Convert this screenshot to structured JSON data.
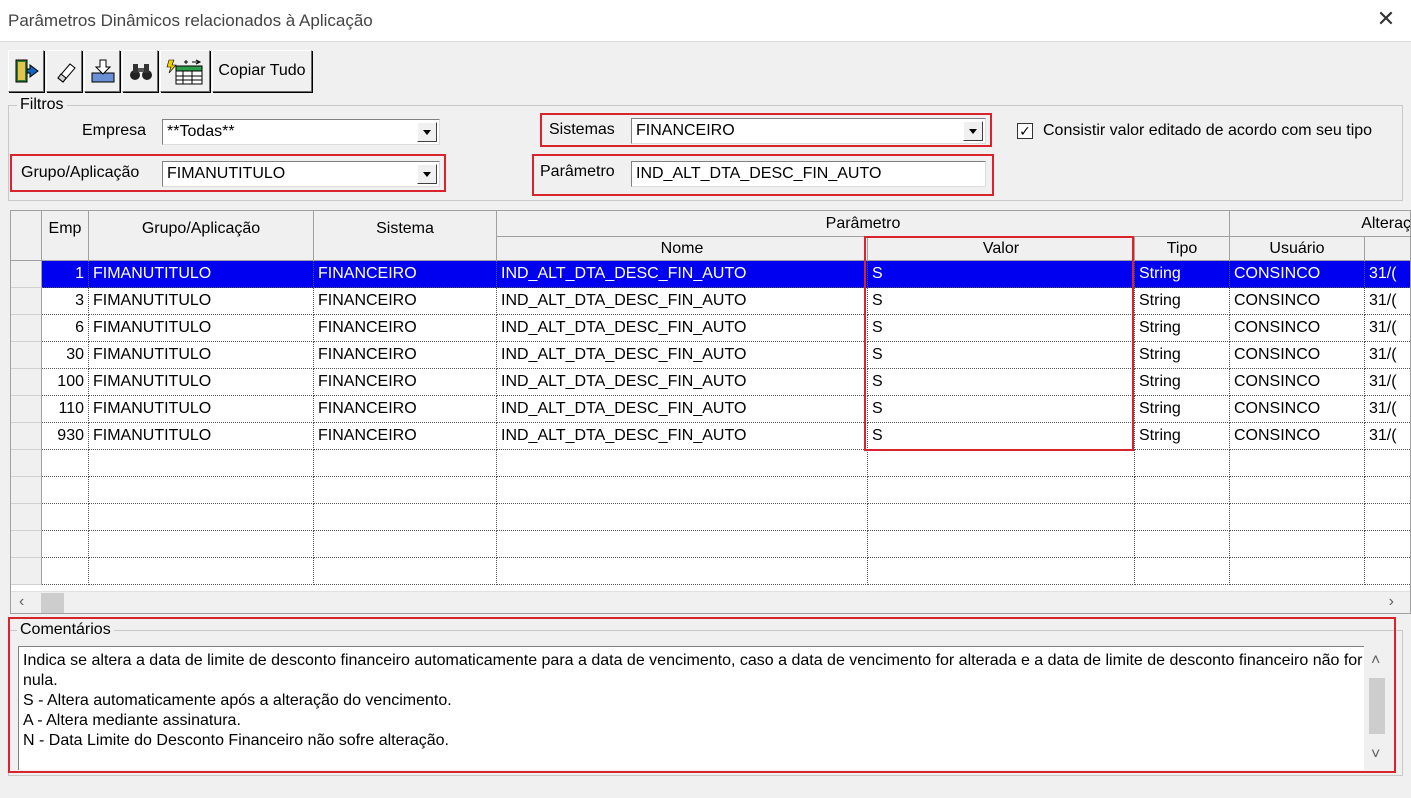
{
  "window": {
    "title": "Parâmetros Dinâmicos relacionados à Aplicação"
  },
  "toolbar": {
    "buttons": [
      {
        "icon": "exit-door-icon"
      },
      {
        "icon": "eraser-icon"
      },
      {
        "icon": "save-download-icon"
      },
      {
        "icon": "binoculars-icon"
      },
      {
        "icon": "grid-table-icon"
      }
    ],
    "copy_all_label": "Copiar Tudo"
  },
  "filters": {
    "legend": "Filtros",
    "empresa_label": "Empresa",
    "empresa_value": "**Todas**",
    "grupo_label": "Grupo/Aplicação",
    "grupo_value": "FIMANUTITULO",
    "sistemas_label": "Sistemas",
    "sistemas_value": "FINANCEIRO",
    "parametro_label": "Parâmetro",
    "parametro_value": "IND_ALT_DTA_DESC_FIN_AUTO",
    "consistir_label": "Consistir valor editado de acordo com seu tipo",
    "consistir_checked": true
  },
  "grid": {
    "headers": {
      "emp": "Emp",
      "grupo": "Grupo/Aplicação",
      "sistema": "Sistema",
      "parametro": "Parâmetro",
      "nome": "Nome",
      "valor": "Valor",
      "tipo": "Tipo",
      "alteracao": "Alteraç",
      "usuario": "Usuário"
    },
    "rows": [
      {
        "emp": "1",
        "grupo": "FIMANUTITULO",
        "sistema": "FINANCEIRO",
        "nome": "IND_ALT_DTA_DESC_FIN_AUTO",
        "valor": "S",
        "tipo": "String",
        "usuario": "CONSINCO",
        "data": "31/("
      },
      {
        "emp": "3",
        "grupo": "FIMANUTITULO",
        "sistema": "FINANCEIRO",
        "nome": "IND_ALT_DTA_DESC_FIN_AUTO",
        "valor": "S",
        "tipo": "String",
        "usuario": "CONSINCO",
        "data": "31/("
      },
      {
        "emp": "6",
        "grupo": "FIMANUTITULO",
        "sistema": "FINANCEIRO",
        "nome": "IND_ALT_DTA_DESC_FIN_AUTO",
        "valor": "S",
        "tipo": "String",
        "usuario": "CONSINCO",
        "data": "31/("
      },
      {
        "emp": "30",
        "grupo": "FIMANUTITULO",
        "sistema": "FINANCEIRO",
        "nome": "IND_ALT_DTA_DESC_FIN_AUTO",
        "valor": "S",
        "tipo": "String",
        "usuario": "CONSINCO",
        "data": "31/("
      },
      {
        "emp": "100",
        "grupo": "FIMANUTITULO",
        "sistema": "FINANCEIRO",
        "nome": "IND_ALT_DTA_DESC_FIN_AUTO",
        "valor": "S",
        "tipo": "String",
        "usuario": "CONSINCO",
        "data": "31/("
      },
      {
        "emp": "110",
        "grupo": "FIMANUTITULO",
        "sistema": "FINANCEIRO",
        "nome": "IND_ALT_DTA_DESC_FIN_AUTO",
        "valor": "S",
        "tipo": "String",
        "usuario": "CONSINCO",
        "data": "31/("
      },
      {
        "emp": "930",
        "grupo": "FIMANUTITULO",
        "sistema": "FINANCEIRO",
        "nome": "IND_ALT_DTA_DESC_FIN_AUTO",
        "valor": "S",
        "tipo": "String",
        "usuario": "CONSINCO",
        "data": "31/("
      }
    ],
    "selected_row": 0
  },
  "comments": {
    "legend": "Comentários",
    "lines": [
      "Indica se altera a data de limite de desconto financeiro automaticamente para a data de vencimento, caso a data de vencimento for alterada e a data de limite de desconto financeiro não for",
      "nula.",
      "S - Altera automaticamente após a alteração do vencimento.",
      "A - Altera mediante assinatura.",
      "N - Data Limite do Desconto Financeiro não sofre alteração."
    ]
  },
  "colors": {
    "highlight": "#d9232d",
    "selection": "#0000f0"
  }
}
